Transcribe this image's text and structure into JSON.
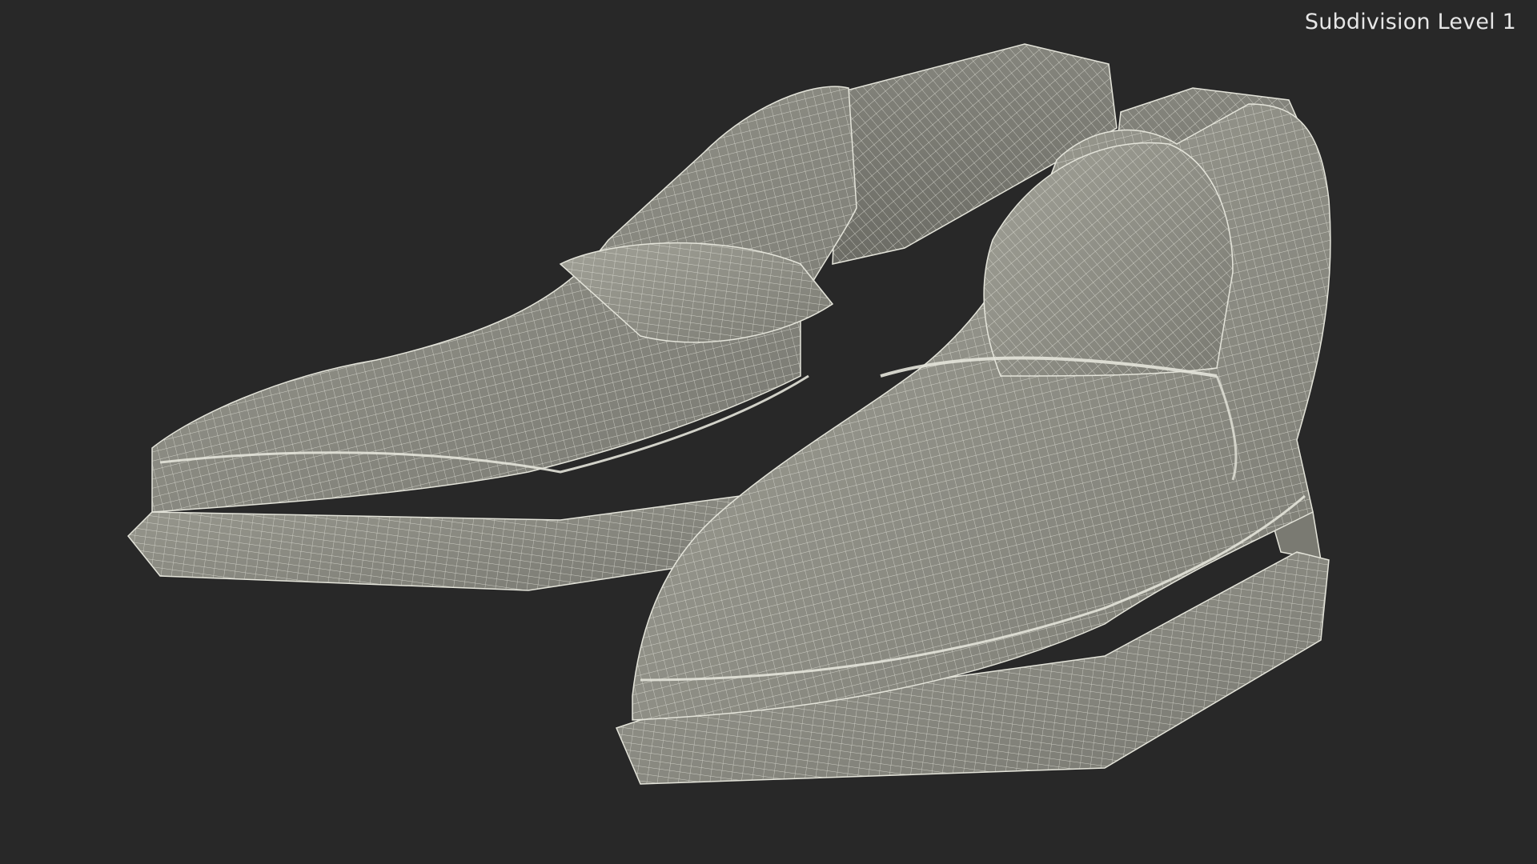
{
  "overlay": {
    "label": "Subdivision Level 1"
  },
  "colors": {
    "background": "#282828",
    "surface": "#8f8f86",
    "surface_dark": "#6e6e66",
    "surface_light": "#a5a59b",
    "wire": "#e4e4da",
    "label_text": "#e6e6e6"
  },
  "scene": {
    "subject": "pair of loafers",
    "render_mode": "wireframe on shaded"
  }
}
